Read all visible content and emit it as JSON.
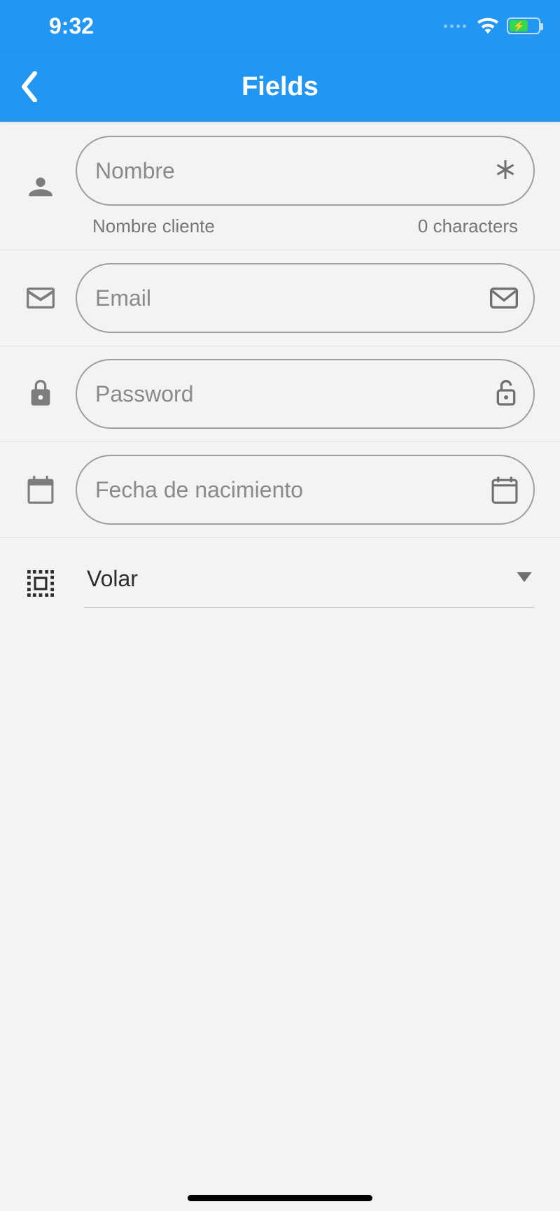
{
  "status": {
    "time": "9:32"
  },
  "nav": {
    "title": "Fields"
  },
  "fields": {
    "name": {
      "placeholder": "Nombre",
      "helper_left": "Nombre cliente",
      "helper_right": "0 characters",
      "value": ""
    },
    "email": {
      "placeholder": "Email",
      "value": ""
    },
    "password": {
      "placeholder": "Password",
      "value": ""
    },
    "dob": {
      "placeholder": "Fecha de nacimiento",
      "value": ""
    },
    "select": {
      "selected": "Volar"
    }
  }
}
